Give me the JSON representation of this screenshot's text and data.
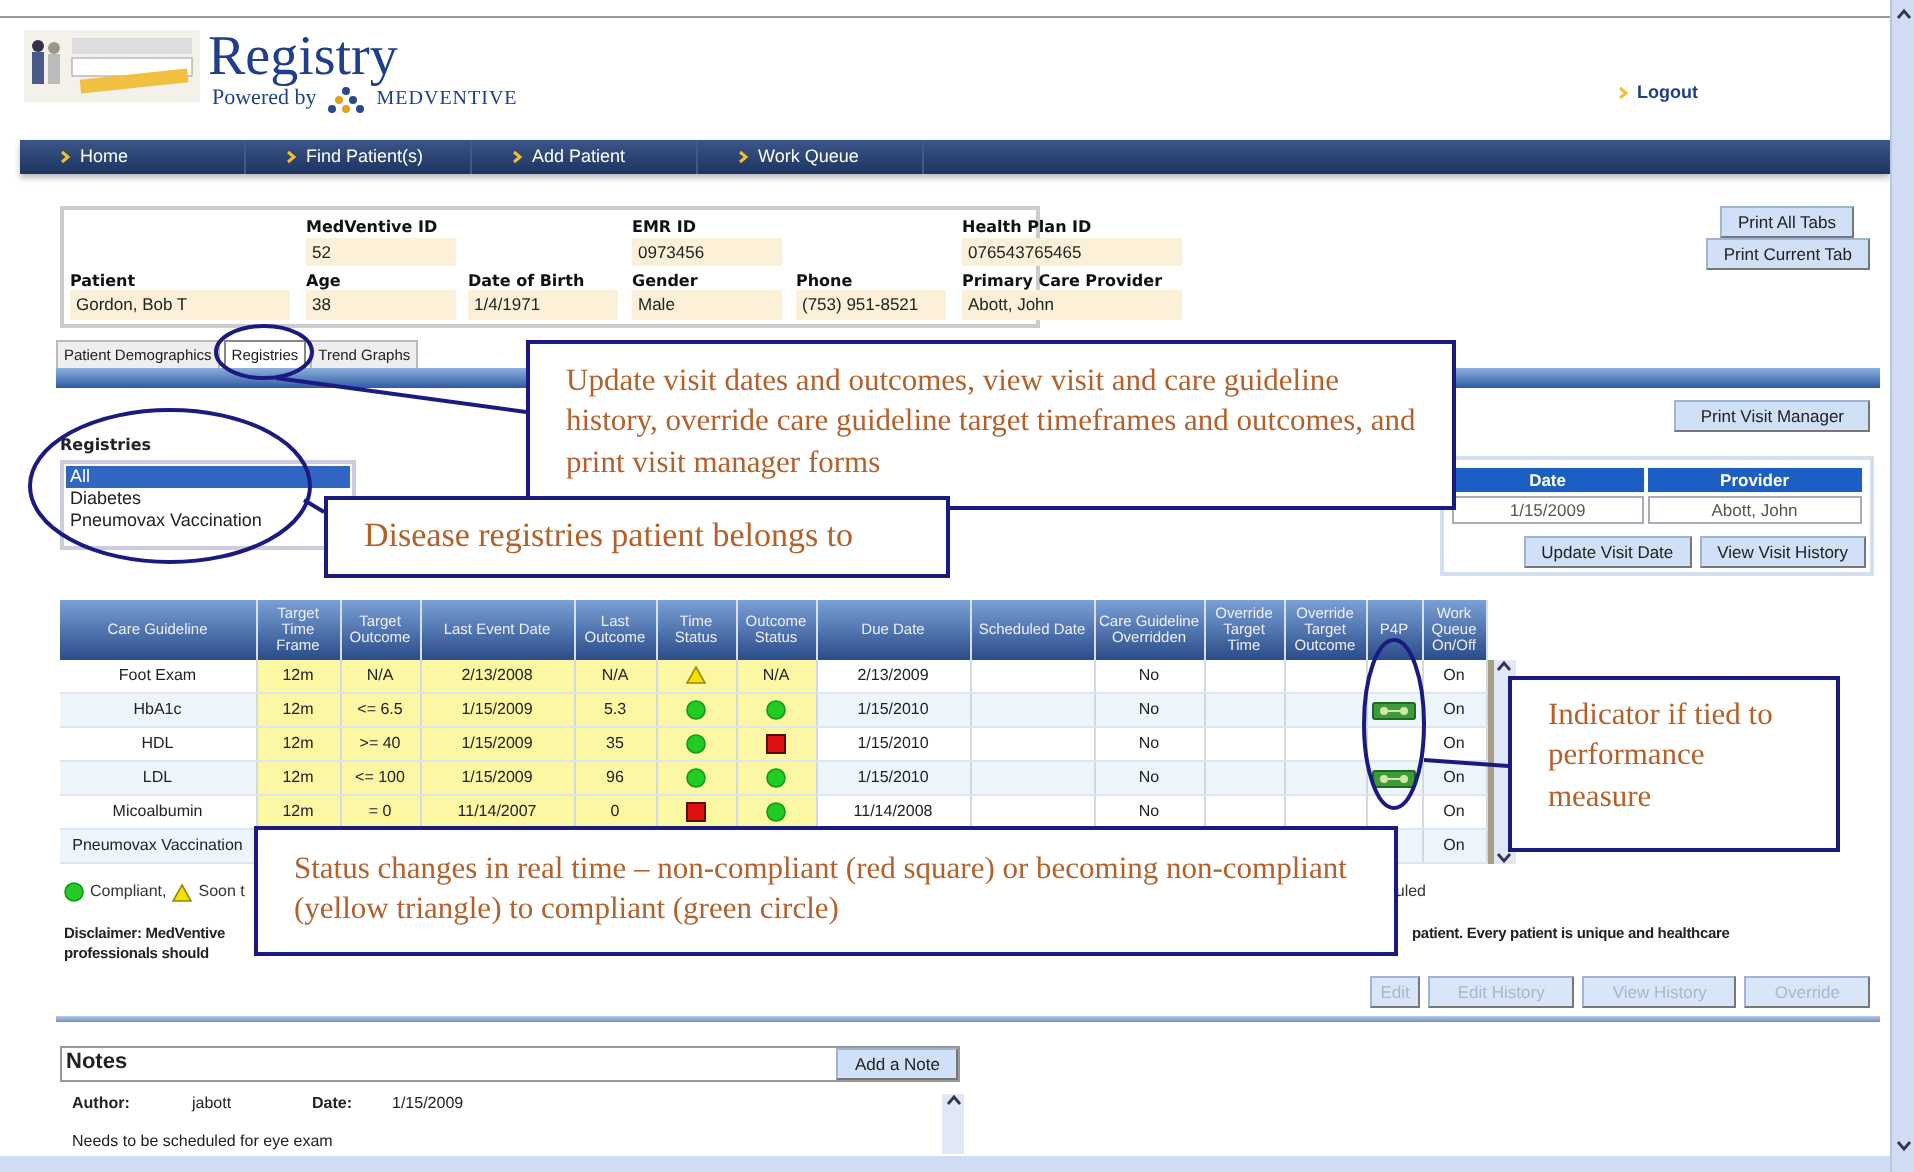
{
  "header": {
    "title": "Registry",
    "powered_by": "Powered by",
    "brand": "MEDVENTIVE",
    "logout": "Logout"
  },
  "nav": [
    {
      "label": "Home"
    },
    {
      "label": "Find Patient(s)"
    },
    {
      "label": "Add Patient"
    },
    {
      "label": "Work Queue"
    }
  ],
  "patient": {
    "top_fields": [
      {
        "label": "MedVentive ID",
        "value": "52"
      },
      {
        "label": "EMR ID",
        "value": "0973456"
      },
      {
        "label": "Health Plan ID",
        "value": "076543765465"
      }
    ],
    "fields": [
      {
        "label": "Patient",
        "value": "Gordon, Bob T"
      },
      {
        "label": "Age",
        "value": "38"
      },
      {
        "label": "Date of Birth",
        "value": "1/4/1971"
      },
      {
        "label": "Gender",
        "value": "Male"
      },
      {
        "label": "Phone",
        "value": "(753) 951-8521"
      },
      {
        "label": "Primary Care Provider",
        "value": "Abott, John"
      }
    ]
  },
  "print_buttons": [
    "Print All Tabs",
    "Print Current Tab"
  ],
  "tabs": [
    {
      "label": "Patient Demographics",
      "selected": false
    },
    {
      "label": "Registries",
      "selected": true
    },
    {
      "label": "Trend Graphs",
      "selected": false
    }
  ],
  "registries": {
    "label": "Registries",
    "items": [
      {
        "label": "All",
        "selected": true
      },
      {
        "label": "Diabetes",
        "selected": false
      },
      {
        "label": "Pneumovax Vaccination",
        "selected": false
      }
    ]
  },
  "print_visit_manager": "Print Visit Manager",
  "visit": {
    "columns": [
      "Date",
      "Provider"
    ],
    "row": [
      "1/15/2009",
      "Abott, John"
    ],
    "buttons": [
      "Update Visit Date",
      "View Visit History"
    ]
  },
  "guidelines": {
    "columns": [
      "Care Guideline",
      "Target Time Frame",
      "Target Outcome",
      "Last Event Date",
      "Last Outcome",
      "Time Status",
      "Outcome Status",
      "Due Date",
      "Scheduled Date",
      "Care Guideline Overridden",
      "Override Target Time",
      "Override Target Outcome",
      "P4P",
      "Work Queue On/Off"
    ],
    "rows": [
      {
        "care_guideline": "Foot Exam",
        "target_time_frame": "12m",
        "target_outcome": "N/A",
        "last_event_date": "2/13/2008",
        "last_outcome": "N/A",
        "time_status": {
          "kind": "soon_due"
        },
        "outcome_status": {
          "kind": "text",
          "text": "N/A"
        },
        "due_date": "2/13/2009",
        "overridden": "No",
        "p4p": false,
        "work_queue": "On"
      },
      {
        "care_guideline": "HbA1c",
        "target_time_frame": "12m",
        "target_outcome": "<= 6.5",
        "last_event_date": "1/15/2009",
        "last_outcome": "5.3",
        "time_status": {
          "kind": "compliant"
        },
        "outcome_status": {
          "kind": "compliant"
        },
        "due_date": "1/15/2010",
        "overridden": "No",
        "p4p": true,
        "work_queue": "On"
      },
      {
        "care_guideline": "HDL",
        "target_time_frame": "12m",
        "target_outcome": ">= 40",
        "last_event_date": "1/15/2009",
        "last_outcome": "35",
        "time_status": {
          "kind": "compliant"
        },
        "outcome_status": {
          "kind": "non_compliant"
        },
        "due_date": "1/15/2010",
        "overridden": "No",
        "p4p": false,
        "work_queue": "On"
      },
      {
        "care_guideline": "LDL",
        "target_time_frame": "12m",
        "target_outcome": "<= 100",
        "last_event_date": "1/15/2009",
        "last_outcome": "96",
        "time_status": {
          "kind": "compliant"
        },
        "outcome_status": {
          "kind": "compliant"
        },
        "due_date": "1/15/2010",
        "overridden": "No",
        "p4p": true,
        "work_queue": "On"
      },
      {
        "care_guideline": "Micoalbumin",
        "target_time_frame": "12m",
        "target_outcome": "= 0",
        "last_event_date": "11/14/2007",
        "last_outcome": "0",
        "time_status": {
          "kind": "non_compliant"
        },
        "outcome_status": {
          "kind": "compliant"
        },
        "due_date": "11/14/2008",
        "overridden": "No",
        "p4p": false,
        "work_queue": "On"
      },
      {
        "care_guideline": "Pneumovax Vaccination",
        "p4p": false,
        "work_queue": "On"
      }
    ]
  },
  "legend": [
    {
      "kind": "compliant",
      "text": "Compliant,"
    },
    {
      "kind": "soon_due",
      "text": "Soon t"
    }
  ],
  "legend_tail": "uled",
  "disclaimer": {
    "start": "Disclaimer: MedVentive",
    "end": "patient. Every patient is unique and healthcare",
    "second_line": "professionals should"
  },
  "grid_buttons": [
    {
      "label": "Edit",
      "disabled": true
    },
    {
      "label": "Edit History",
      "disabled": true
    },
    {
      "label": "View History",
      "disabled": true
    },
    {
      "label": "Override",
      "disabled": true
    }
  ],
  "notes": {
    "title": "Notes",
    "add_button": "Add a Note",
    "entries": [
      {
        "author_label": "Author:",
        "author": "jabott",
        "date_label": "Date:",
        "date": "1/15/2009",
        "text": "Needs to be scheduled for eye exam"
      }
    ]
  },
  "callouts": [
    {
      "text": "Update visit dates and outcomes, view visit and care guideline history, override care guideline target timeframes and outcomes, and print visit manager forms"
    },
    {
      "text": "Disease registries patient belongs to"
    },
    {
      "text": "Indicator if tied to performance measure"
    },
    {
      "text": "Status changes in real time – non-compliant (red square) or becoming non-compliant (yellow triangle) to compliant (green circle)"
    }
  ]
}
